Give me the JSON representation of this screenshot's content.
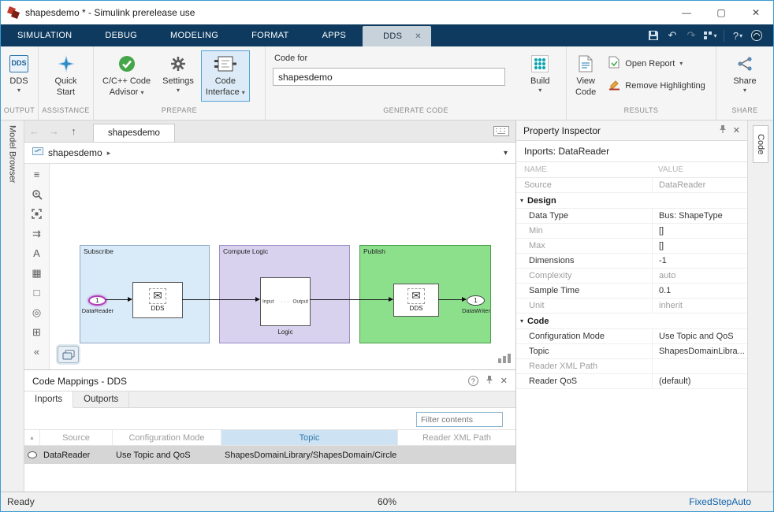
{
  "window": {
    "title": "shapesdemo * - Simulink prerelease use"
  },
  "icons": {
    "minimize": "—",
    "maximize": "▢",
    "close": "✕",
    "undo": "↶",
    "redo": "↷",
    "help": "?",
    "dropdown": "▾",
    "breadcrumb_sep": "▸",
    "back": "←",
    "forward": "→",
    "up": "↑",
    "envelope": "✉",
    "collapse": "«",
    "sort": "▴",
    "hamburger": "≡",
    "route_arrows": "⇉",
    "annotation": "A",
    "image": "▦",
    "rectangle": "□",
    "camera": "◎",
    "grid": "⊞",
    "section_chevron": "▾",
    "question": "?",
    "logic_dots": "···"
  },
  "ribbon_tabs": [
    "SIMULATION",
    "DEBUG",
    "MODELING",
    "FORMAT",
    "APPS"
  ],
  "active_tab": "DDS",
  "ribbon": {
    "output": {
      "section": "OUTPUT",
      "dds_icon": "DDS",
      "dds": "DDS"
    },
    "assistance": {
      "section": "ASSISTANCE",
      "quick": "Quick",
      "start": "Start"
    },
    "prepare": {
      "section": "PREPARE",
      "advisor_l1": "C/C++ Code",
      "advisor_l2": "Advisor",
      "settings": "Settings",
      "interface_l1": "Code",
      "interface_l2": "Interface"
    },
    "generate": {
      "section": "GENERATE CODE",
      "code_for": "Code for",
      "model_name": "shapesdemo",
      "build": "Build"
    },
    "results": {
      "section": "RESULTS",
      "view_l1": "View",
      "view_l2": "Code",
      "open_report": "Open Report",
      "remove_highlighting": "Remove Highlighting"
    },
    "share": {
      "section": "SHARE",
      "share": "Share"
    }
  },
  "side": {
    "model_browser": "Model Browser",
    "code_tab": "Code"
  },
  "editor": {
    "doc_tab": "shapesdemo",
    "breadcrumb": "shapesdemo"
  },
  "diagram": {
    "subscribe": {
      "title": "Subscribe",
      "port_number": "1",
      "port_label": "DataReader",
      "dds": "DDS"
    },
    "compute": {
      "title": "Compute Logic",
      "input": "Input",
      "output": "Output",
      "label": "Logic"
    },
    "publish": {
      "title": "Publish",
      "dds": "DDS",
      "port_number": "1",
      "port_label": "DataWriter"
    }
  },
  "code_mappings": {
    "title": "Code Mappings - DDS",
    "tabs": [
      "Inports",
      "Outports"
    ],
    "filter_placeholder": "Filter contents",
    "headers": [
      "Source",
      "Configuration Mode",
      "Topic",
      "Reader XML Path"
    ],
    "row": {
      "source": "DataReader",
      "mode": "Use Topic and QoS",
      "topic": "ShapesDomainLibrary/ShapesDomain/Circle",
      "xml": ""
    }
  },
  "property_inspector": {
    "title": "Property Inspector",
    "subtitle": "Inports: DataReader",
    "col_name": "NAME",
    "col_value": "VALUE",
    "source_row": {
      "name": "Source",
      "value": "DataReader"
    },
    "design_section": "Design",
    "design_rows": [
      {
        "name": "Data Type",
        "value": "Bus: ShapeType"
      },
      {
        "name": "Min",
        "value": "[]"
      },
      {
        "name": "Max",
        "value": "[]"
      },
      {
        "name": "Dimensions",
        "value": "-1"
      },
      {
        "name": "Complexity",
        "value": "auto"
      },
      {
        "name": "Sample Time",
        "value": "0.1"
      },
      {
        "name": "Unit",
        "value": "inherit"
      }
    ],
    "code_section": "Code",
    "code_rows": [
      {
        "name": "Configuration Mode",
        "value": "Use Topic and QoS"
      },
      {
        "name": "Topic",
        "value": "ShapesDomainLibra..."
      },
      {
        "name": "Reader XML Path",
        "value": ""
      },
      {
        "name": "Reader QoS",
        "value": "(default)"
      }
    ]
  },
  "status": {
    "ready": "Ready",
    "zoom": "60%",
    "solver": "FixedStepAuto"
  }
}
